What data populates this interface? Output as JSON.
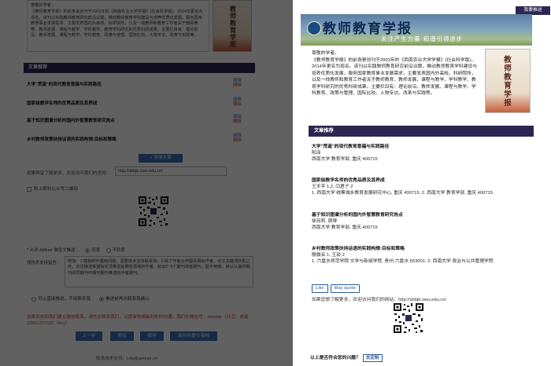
{
  "editor": {
    "intro_paragraphs": [
      "尊敬的学者，",
      "《教师教育学报》的前身是创刊于2003年的《西南农业大学学报》(社会科学版)，2014年更名为现名。该刊以实践教师教育研究前沿议题，推动教师教育学科建设与培养优质化发展，服务国家教育事业发展需求，主要发表国内外高校、科研院所，以及一线教师和教育工作者关于教师教育、教师发展、课程与教学、学科教学、教育学科研究的优秀科研成果。主要栏目有：理论前沿、教师发展、课程与教学、学科教育、政策与管理、国际比较、人物专访、改革与实践等。"
    ],
    "section_header": "文章推荐",
    "articles": [
      {
        "title": "大学\"荒诞\"的现代教育意蕴与实践路径",
        "edit": "编辑",
        "del": "删除"
      },
      {
        "title": "国家级教学名师的优秀品质及其养成",
        "edit": "编辑",
        "del": "删除"
      },
      {
        "title": "基于知识图谱分析的国内外智慧教育研究热点",
        "edit": "编辑",
        "del": "删除"
      },
      {
        "title": "乡村教师政策扶持话语的实践构想:目标和策略",
        "edit": "编辑",
        "del": "删除"
      }
    ],
    "add_article_label": "+ 添加文章",
    "more_label": "如果希望了解更多，欢迎访问我们的官网：",
    "more_url": "http://xbbjb.swu.edu.cn/",
    "qr_checkbox_label": "附上期刊公众号二维码",
    "authorize_label": "* 允许 AMiner 做全文推送：",
    "authorize_yes": "同意",
    "authorize_no": "不同意",
    "desc_label": "领技术支持留言：",
    "desc_text": "例如：1.模板制作遇到问题，需要技术支持联系我；2.除了作者合作圈及相似作者，论文关键词匹配之外，本次推送希望指定须推送给哪些领域的作者，给出2~3个期刊或者频刊，能不用删，默认从最终期刊的同期刊中期刊期刊推送给作者期刊。",
    "opt_direct": "可以直接推送，不用联系我",
    "opt_confirm": "推送前再次联系我确认",
    "note": "如果尚未和我们建立微信联系，请先必联系我们，以便审核模板时即时沟通，我们的微信号：dairdair（孙玉）或者 13901207032（Avy）",
    "buttons": {
      "prev": "上一步",
      "preview": "预览",
      "save": "保存",
      "submit": "保存并提交审核"
    },
    "footer": "联系技术支持：info@aminer.cn"
  },
  "preview": {
    "recommend_button": "我要推送",
    "banner_title": "教师教育学报",
    "banner_slogan": "关注产生力量 和谐引领进步",
    "greeting": "尊敬的学者，",
    "intro": "《教师教育学报》的前身是创刊于2003年的《西南农业大学学报》(社会科学版)，2014年更名为现名。该刊以实践教师教育研究前沿议题，推动教师教育学科建设与培养优质化发展，服务国家教育事业发展需求，主要发表国内外高校、科研院所，以及一线教师和教育工作者关于教师教育、教师发展、课程与教学、学科教学、教育学科研究的优秀科研成果。主要栏目有：理论前沿、教师发展、课程与教学、学科教育、政策与管理、国际比较、人物专访、改革与实践等。",
    "cover_title": "教师教育学报",
    "section_header": "文章推荐",
    "articles": [
      {
        "title": "大学\"荒诞\"的现代教育意蕴与实践路径",
        "authors": "阳泽",
        "affil": "西南大学 教育学部, 重庆 400715"
      },
      {
        "title": "国家级教学名师的优秀品质及其养成",
        "authors": "王天平 1,2, 闫君子 2",
        "affil": "1. 西南大学 统筹城乡教育发展研究中心, 重庆 400715; 2. 西南大学 教育学部, 重庆 400715"
      },
      {
        "title": "基于知识图谱分析的国内外智慧教育研究热点",
        "authors": "徐宛莉, 周琴",
        "affil": "西南大学 教育学部, 重庆 400715"
      },
      {
        "title": "乡村教师政策扶持话语的实践构想:目标和策略",
        "authors": "殷鼓云 1, 王琰 2",
        "affil": "1. 六盘水师范学院 文学与新闻学院, 贵州 六盘水 553001; 2. 西南大学 政治与公共管理学院"
      }
    ],
    "like": "Like",
    "quote": "May quote",
    "more": "如果您想了解更多，欢迎访问我们的网站：http://xbbjb.swu.edu.cn/",
    "ask": "以上是否符合您的兴趣？",
    "ask_button": "去定制"
  },
  "icons": {
    "qr": "qr-code-icon",
    "logo": "journal-logo-icon"
  },
  "colors": {
    "header": "#2d2653",
    "button": "#3a6fb5",
    "delete": "#cc3333",
    "note": "#cc3333"
  }
}
